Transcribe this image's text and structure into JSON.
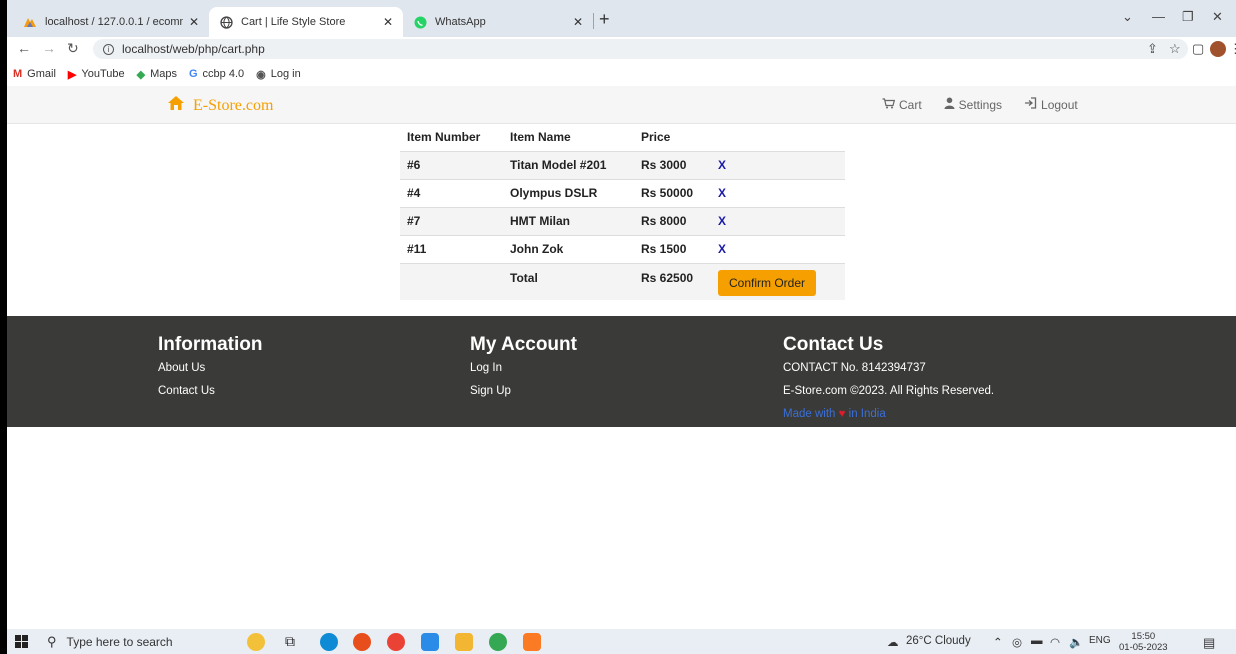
{
  "browser": {
    "tabs": [
      {
        "title": "localhost / 127.0.0.1 / ecommerc",
        "icon": "phpmyadmin-icon"
      },
      {
        "title": "Cart | Life Style Store",
        "icon": "globe-icon",
        "active": true
      },
      {
        "title": "WhatsApp",
        "icon": "whatsapp-icon"
      }
    ],
    "new_tab": "+",
    "url": "localhost/web/php/cart.php",
    "bookmarks": [
      {
        "label": "Gmail",
        "icon": "gmail-icon",
        "color": "#d93025"
      },
      {
        "label": "YouTube",
        "icon": "youtube-icon",
        "color": "#ff0000"
      },
      {
        "label": "Maps",
        "icon": "maps-icon",
        "color": "#34a853"
      },
      {
        "label": "ccbp 4.0",
        "icon": "google-icon",
        "color": "#4285f4"
      },
      {
        "label": "Log in",
        "icon": "globe-icon",
        "color": "#555555"
      }
    ]
  },
  "site": {
    "brand": "E-Store.com",
    "brand_color": "#f5a000",
    "nav": [
      {
        "label": "Cart",
        "icon": "cart-icon"
      },
      {
        "label": "Settings",
        "icon": "user-icon"
      },
      {
        "label": "Logout",
        "icon": "logout-icon"
      }
    ]
  },
  "cart": {
    "headers": [
      "Item Number",
      "Item Name",
      "Price"
    ],
    "items": [
      {
        "number": "#6",
        "name": "Titan Model #201",
        "price": "Rs 3000",
        "remove": "X"
      },
      {
        "number": "#4",
        "name": "Olympus DSLR",
        "price": "Rs 50000",
        "remove": "X"
      },
      {
        "number": "#7",
        "name": "HMT Milan",
        "price": "Rs 8000",
        "remove": "X"
      },
      {
        "number": "#11",
        "name": "John Zok",
        "price": "Rs 1500",
        "remove": "X"
      }
    ],
    "total_label": "Total",
    "total_value": "Rs 62500",
    "confirm_label": "Confirm Order"
  },
  "footer": {
    "information": {
      "title": "Information",
      "links": [
        "About Us",
        "Contact Us"
      ]
    },
    "account": {
      "title": "My Account",
      "links": [
        "Log In",
        "Sign Up"
      ]
    },
    "contact": {
      "title": "Contact Us",
      "phone": "CONTACT No.  8142394737",
      "copyright": "E-Store.com ©2023.  All Rights Reserved.",
      "made_prefix": "Made with",
      "made_suffix": "in India"
    }
  },
  "taskbar": {
    "search_placeholder": "Type here to search",
    "weather": "26°C  Cloudy",
    "language": "ENG",
    "time": "15:50",
    "date": "01-05-2023"
  }
}
